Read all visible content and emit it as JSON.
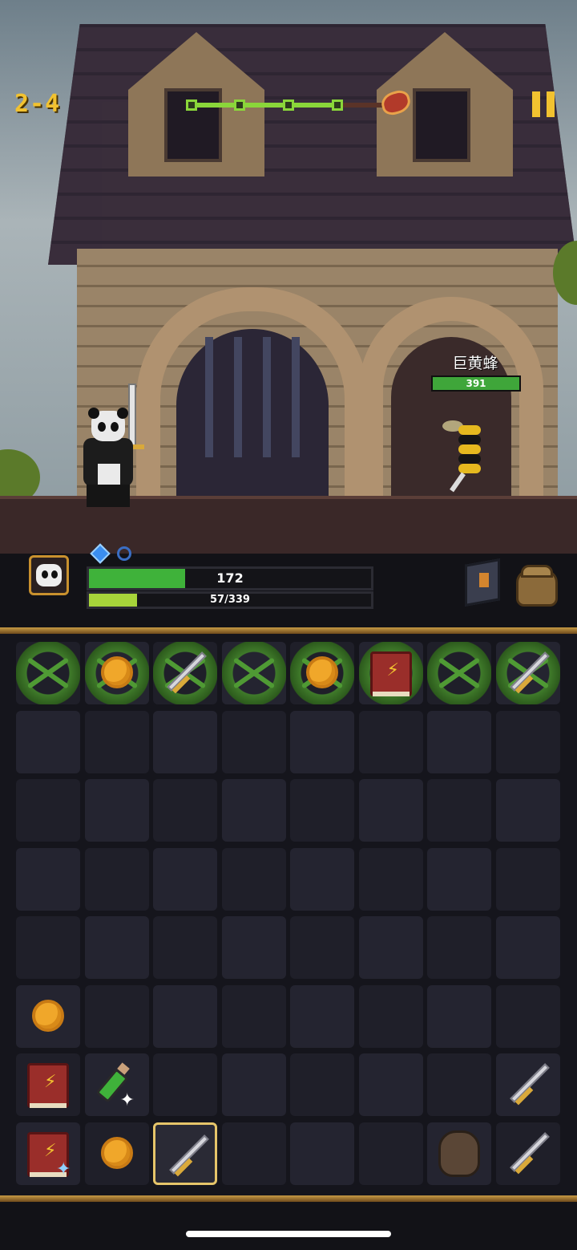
{
  "level": {
    "label": "2-4"
  },
  "stage_progress": {
    "nodes": 4,
    "current": 4,
    "boss": true
  },
  "enemy": {
    "name": "巨黄蜂",
    "hp_label": "391",
    "hp_fraction": 1.0
  },
  "player": {
    "hp_label": "172",
    "hp_fraction": 0.34,
    "xp_label": "57/339",
    "xp_fraction": 0.17,
    "gems_filled": 1,
    "gems_total": 2
  },
  "buttons": {
    "spellbook": "spellbook-icon",
    "bag": "backpack-icon"
  },
  "colors": {
    "accent": "#f2c230",
    "hp": "#3fb23a",
    "xp": "#a7d43a",
    "frame": "#c79a45"
  },
  "board": {
    "columns": 8,
    "rows": 8,
    "slots": [
      {
        "row": 0,
        "col": 0,
        "item": "vine"
      },
      {
        "row": 0,
        "col": 1,
        "item": "coin",
        "vine": true
      },
      {
        "row": 0,
        "col": 2,
        "item": "sword",
        "vine": true
      },
      {
        "row": 0,
        "col": 3,
        "item": "vine"
      },
      {
        "row": 0,
        "col": 4,
        "item": "coin",
        "vine": true
      },
      {
        "row": 0,
        "col": 5,
        "item": "book",
        "vine": true
      },
      {
        "row": 0,
        "col": 6,
        "item": "vine"
      },
      {
        "row": 0,
        "col": 7,
        "item": "sword",
        "vine": true
      },
      {
        "row": 5,
        "col": 0,
        "item": "coin"
      },
      {
        "row": 6,
        "col": 0,
        "item": "book"
      },
      {
        "row": 6,
        "col": 1,
        "item": "potion"
      },
      {
        "row": 6,
        "col": 7,
        "item": "sword"
      },
      {
        "row": 7,
        "col": 0,
        "item": "book",
        "sparkle": "blue"
      },
      {
        "row": 7,
        "col": 1,
        "item": "coin"
      },
      {
        "row": 7,
        "col": 2,
        "item": "sword",
        "selected": true
      },
      {
        "row": 7,
        "col": 6,
        "item": "rock"
      },
      {
        "row": 7,
        "col": 7,
        "item": "sword"
      }
    ]
  }
}
